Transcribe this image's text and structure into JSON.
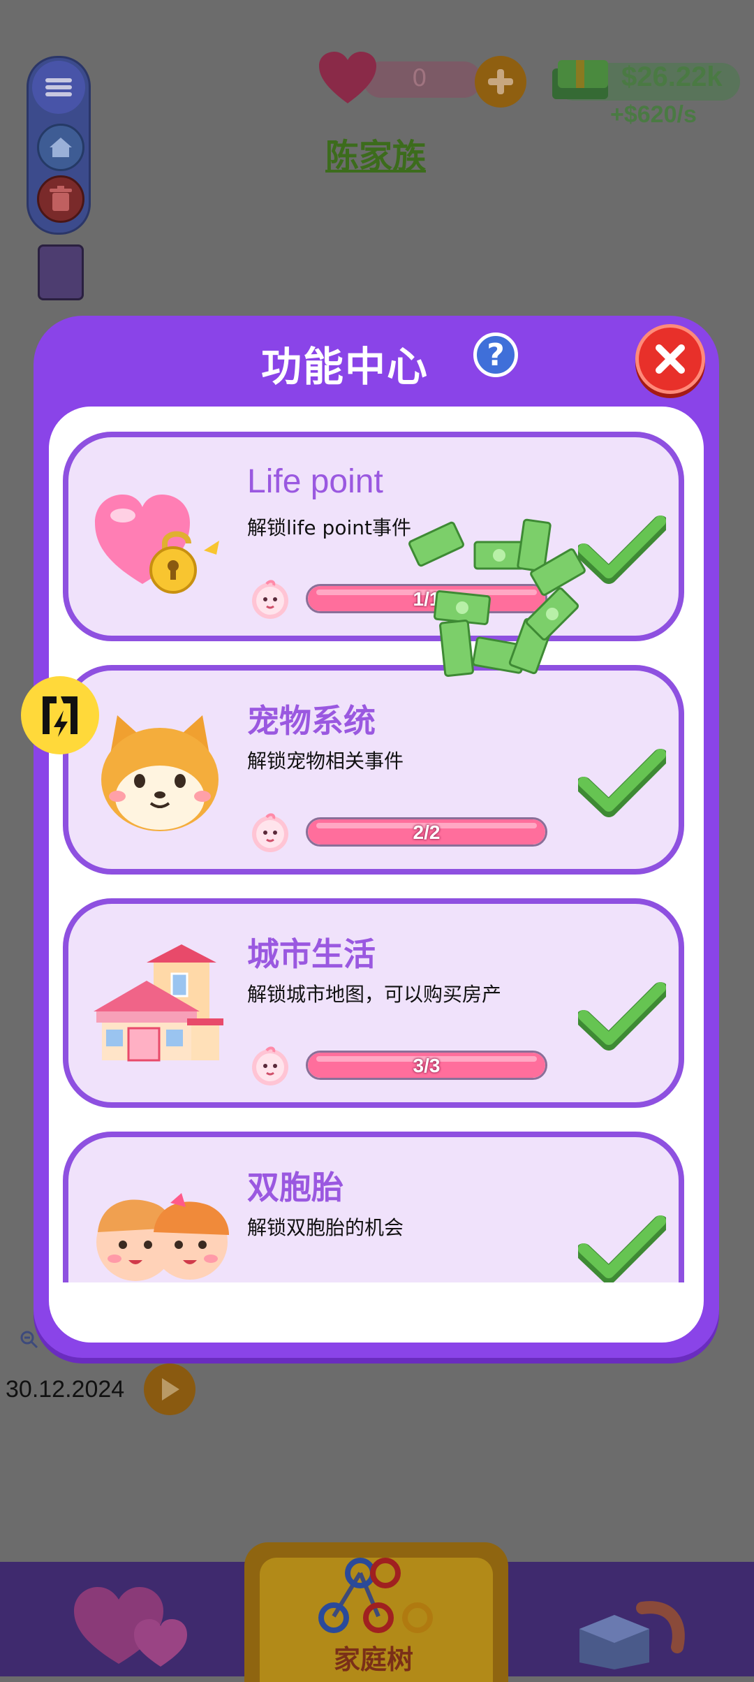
{
  "hud": {
    "hearts_count": "0",
    "money": "$26.22k",
    "money_rate": "+$620/s",
    "family_name": "陈家族",
    "date": "30.12.2024"
  },
  "icons": [
    "menu-icon",
    "home-icon",
    "trash-icon",
    "rules-book-icon",
    "heart-icon",
    "plus-icon",
    "money-stack-icon",
    "zoom-out-icon",
    "play-icon",
    "flash-icon",
    "help-icon",
    "close-icon",
    "check-icon",
    "baby-icon",
    "family-tree-icon",
    "shop-icon"
  ],
  "modal": {
    "title": "功能中心",
    "help_label": "?",
    "cards": [
      {
        "title": "Life point",
        "desc": "解锁life point事件",
        "progress_text": "1/1",
        "progress": 1.0
      },
      {
        "title": "宠物系统",
        "desc": "解锁宠物相关事件",
        "progress_text": "2/2",
        "progress": 1.0
      },
      {
        "title": "城市生活",
        "desc": "解锁城市地图，可以购买房产",
        "progress_text": "3/3",
        "progress": 1.0
      },
      {
        "title": "双胞胎",
        "desc": "解锁双胞胎的机会"
      }
    ]
  },
  "bottom_nav": {
    "tree_label": "家庭树"
  },
  "colors": {
    "modal_purple": "#8a44e8",
    "card_bg": "#f0e2fb",
    "title_purple": "#9a58e0",
    "progress_pink": "#ff6e9c",
    "check_green": "#5cc049",
    "close_red": "#e8302a"
  }
}
